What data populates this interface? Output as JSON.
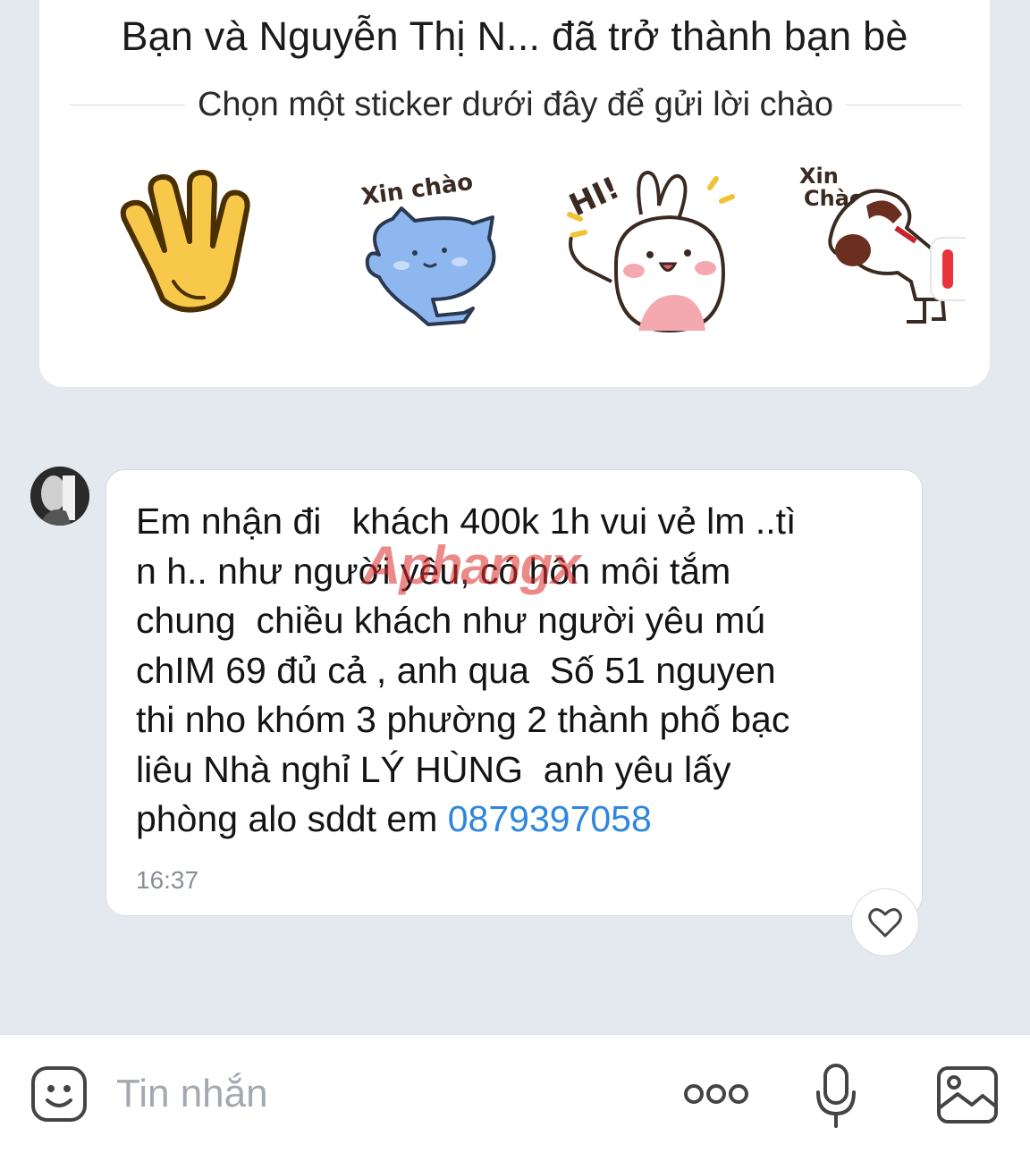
{
  "friend_card": {
    "title": "Bạn và Nguyễn Thị N... đã trở thành bạn bè",
    "subtitle": "Chọn một sticker dưới đây để gửi lời chào",
    "stickers": [
      {
        "icon": "waving-hand-icon"
      },
      {
        "icon": "blue-cat-sticker",
        "caption": "Xin chào"
      },
      {
        "icon": "white-bunny-sticker",
        "caption": "HI!"
      },
      {
        "icon": "dog-sticker",
        "caption_line1": "Xin",
        "caption_line2": "Chào"
      }
    ]
  },
  "message": {
    "text_main": "Em nhận đi   khách 400k 1h vui vẻ lm ..tì\nn h.. như người yêu, có hôn môi tắm\nchung  chiều khách như người yêu mú\nchIM 69 đủ cả , anh qua  Số 51 nguyen\nthi nho khóm 3 phường 2 thành phố bạc\nliêu Nhà nghỉ LÝ HÙNG  anh yêu lấy\nphòng alo sddt em ",
    "phone": "0879397058",
    "time": "16:37"
  },
  "watermark": "Aphangx",
  "input_bar": {
    "placeholder": "Tin nhắn",
    "icons": [
      "emoji-icon",
      "more-icon",
      "microphone-icon",
      "image-icon"
    ]
  },
  "colors": {
    "background": "#e4e8ef",
    "link": "#2e86de",
    "accent_red": "#e8343a"
  }
}
